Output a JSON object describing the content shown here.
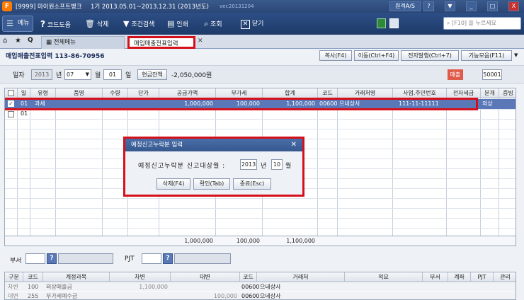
{
  "title": {
    "company": "[9999] 마이원소프트뱅크",
    "period": "1기 2013.05.01~2013.12.31 (2013년도)",
    "version": "ver.20131204",
    "remote": "원격A/S",
    "controls": [
      "?",
      "▼",
      "_",
      "□",
      "X"
    ]
  },
  "toolbar": {
    "menu": "메뉴",
    "help": "코드도움",
    "delete": "삭제",
    "search_cond": "조건검색",
    "print": "인쇄",
    "inquiry": "조회",
    "close": "닫기",
    "search_placeholder": "[F10] 을 누르세요"
  },
  "tabs": {
    "all_menu": "전체메뉴",
    "current": "매입매출전표입력"
  },
  "sub": {
    "title": "매입매출전표입력 113-86-70956",
    "buttons": [
      "복사(F4)",
      "이동(Ctrl+F4)",
      "전자발행(Ctrl+7)",
      "기능모음(F11)"
    ]
  },
  "datebar": {
    "label_date": "일자",
    "year": "2013",
    "year_unit": "년",
    "month": "07",
    "month_unit": "월",
    "day": "01",
    "day_unit": "일",
    "cash_btn": "현금잔액",
    "cash_amt": "-2,050,000원",
    "sales_badge": "매출",
    "code": "50001"
  },
  "grid": {
    "headers": [
      "",
      "일",
      "유형",
      "품명",
      "수량",
      "단가",
      "공급가액",
      "부가세",
      "합계",
      "코드",
      "거래처명",
      "사업.주민번호",
      "전자세금",
      "분개",
      "증빙"
    ],
    "row1": {
      "day": "01",
      "type": "과세",
      "supply": "1,000,000",
      "vat": "100,000",
      "total": "1,100,000",
      "code": "00600",
      "partner": "으네상사",
      "bizno": "111-11-11111",
      "journal": "외상"
    },
    "row2": {
      "day": "01"
    },
    "totals": {
      "supply": "1,000,000",
      "vat": "100,000",
      "total": "1,100,000"
    }
  },
  "dialog": {
    "title": "예정신고누락분 입력",
    "label": "예정신고누락분 신고대상월 :",
    "year": "2013",
    "year_unit": "년",
    "month": "10",
    "month_unit": "월",
    "btn_delete": "삭제(F4)",
    "btn_ok": "확인(Tab)",
    "btn_close": "종료(Esc)"
  },
  "bottom": {
    "dept_label": "부서",
    "pjt_label": "PJT"
  },
  "lower": {
    "headers": [
      "구분",
      "코드",
      "계정과목",
      "차변",
      "대변",
      "코드",
      "거래처",
      "적요",
      "부서",
      "계좌",
      "PJT",
      "관리"
    ],
    "rows": [
      {
        "div": "차변",
        "code": "100",
        "account": "외상매출금",
        "debit": "1,100,000",
        "credit": "",
        "pcode": "00600",
        "partner": "으네상사"
      },
      {
        "div": "대변",
        "code": "255",
        "account": "부가세예수금",
        "debit": "",
        "credit": "100,000",
        "pcode": "00600",
        "partner": "으네상사"
      }
    ]
  }
}
